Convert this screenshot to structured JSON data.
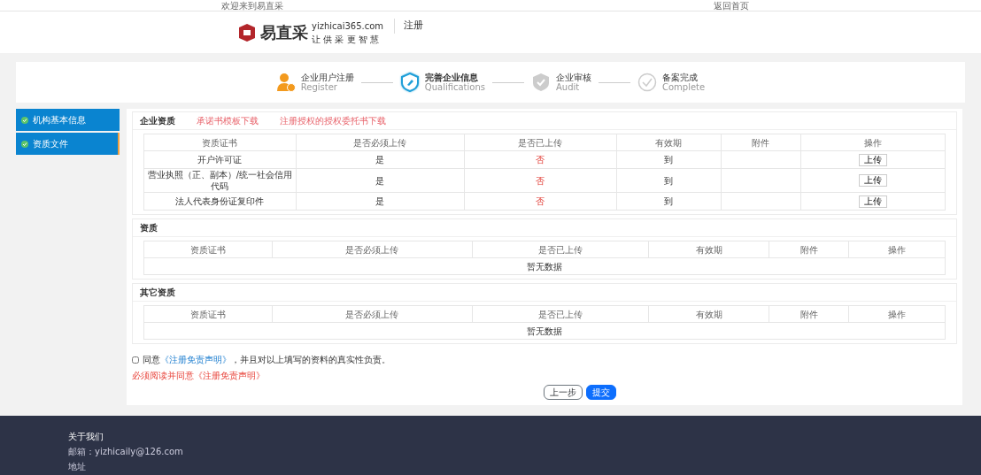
{
  "top_bar": {
    "welcome": "欢迎来到易直采",
    "home_link": "返回首页"
  },
  "header": {
    "logo_name": "易直采",
    "logo_domain": "yizhicai365.com",
    "logo_slogan": "让 供 采 更 智 慧",
    "page_title": "注册"
  },
  "steps": [
    {
      "title": "企业用户注册",
      "subtitle": "Register",
      "completed": true,
      "selected": false
    },
    {
      "title": "完善企业信息",
      "subtitle": "Qualifications",
      "completed": false,
      "selected": true
    },
    {
      "title": "企业审核",
      "subtitle": "Audit",
      "completed": false,
      "selected": false
    },
    {
      "title": "备案完成",
      "subtitle": "Complete",
      "completed": false,
      "selected": false
    }
  ],
  "sidebar": {
    "items": [
      {
        "label": "机构基本信息",
        "checked": true,
        "selected": false
      },
      {
        "label": "资质文件",
        "checked": true,
        "selected": true
      }
    ]
  },
  "sections": [
    {
      "title": "企业资质",
      "links": [
        "承诺书模板下载",
        "注册授权的授权委托书下载"
      ],
      "columns": [
        "资质证书",
        "是否必须上传",
        "是否已上传",
        "有效期",
        "附件",
        "操作"
      ],
      "rows": [
        {
          "name": "开户许可证",
          "required": "是",
          "uploaded": "否",
          "validity": "到",
          "action": "上传"
        },
        {
          "name": "营业执照（正、副本）/统一社会信用代码",
          "required": "是",
          "uploaded": "否",
          "validity": "到",
          "action": "上传"
        },
        {
          "name": "法人代表身份证复印件",
          "required": "是",
          "uploaded": "否",
          "validity": "到",
          "action": "上传"
        }
      ]
    },
    {
      "title": "资质",
      "columns": [
        "资质证书",
        "是否必须上传",
        "是否已上传",
        "有效期",
        "附件",
        "操作"
      ],
      "empty": "暂无数据"
    },
    {
      "title": "其它资质",
      "columns": [
        "资质证书",
        "是否必须上传",
        "是否已上传",
        "有效期",
        "附件",
        "操作"
      ],
      "empty": "暂无数据"
    }
  ],
  "agreement": {
    "checked": false,
    "text_before": "同意",
    "link": "《注册免责声明》",
    "text_after": "，并且对以上填写的资料的真实性负责。",
    "error": "必须阅读并同意《注册免责声明》"
  },
  "buttons": [
    {
      "label": "上一步",
      "kind": "secondary"
    },
    {
      "label": "提交",
      "kind": "primary"
    }
  ],
  "footer": {
    "title": "关于我们",
    "email": "邮箱：yizhicaily@126.com",
    "address": "地址"
  }
}
